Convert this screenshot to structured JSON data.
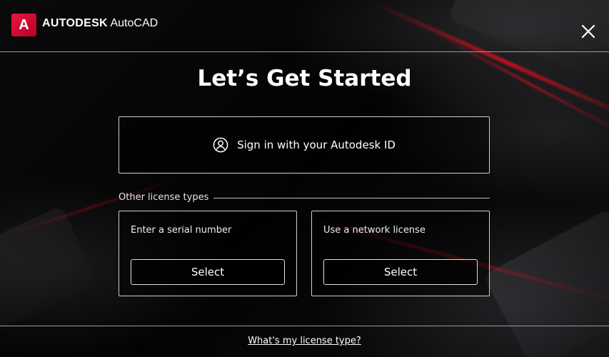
{
  "header": {
    "logo_letter": "A",
    "brand_name": "AUTODESK",
    "product_name": "AutoCAD"
  },
  "title": "Let’s Get Started",
  "signin": {
    "label": "Sign in with your Autodesk ID"
  },
  "other_licenses": {
    "label": "Other license types",
    "options": [
      {
        "title": "Enter a serial number",
        "button": "Select"
      },
      {
        "title": "Use a network license",
        "button": "Select"
      }
    ]
  },
  "footer": {
    "link": "What's my license type?"
  },
  "colors": {
    "background": "#050505",
    "accent_red": "#e8183c",
    "border": "#cfcfcf",
    "text": "#ffffff"
  },
  "icons": {
    "close": "close-icon",
    "user": "user-circle-icon"
  }
}
